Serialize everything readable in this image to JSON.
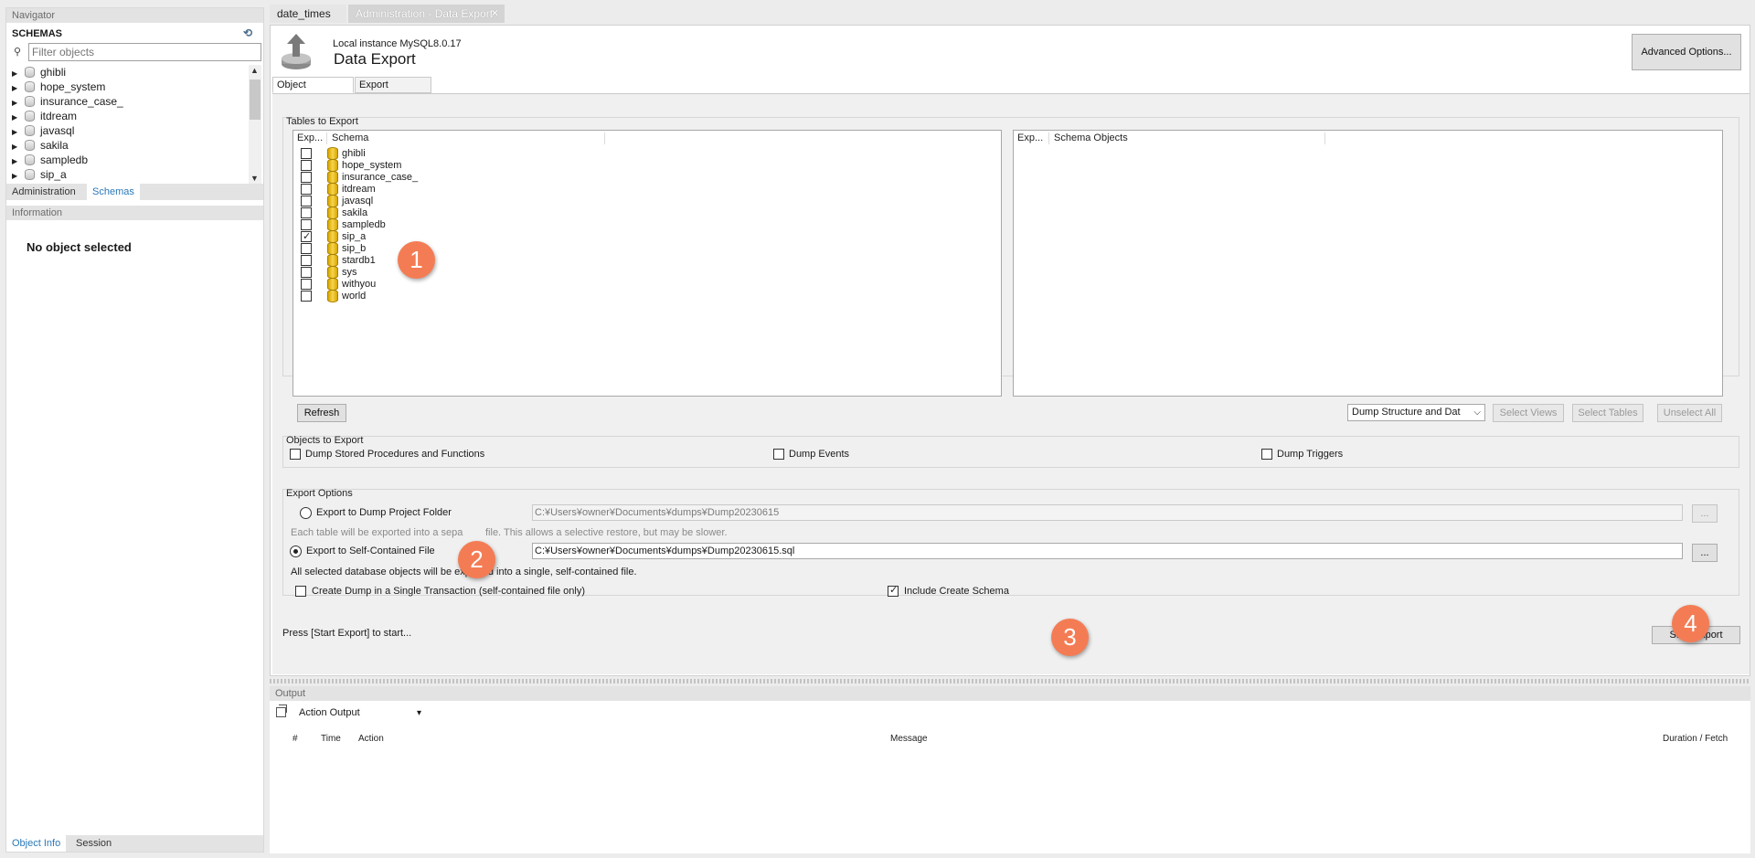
{
  "navigator": {
    "header": "Navigator",
    "schemas_title": "SCHEMAS",
    "filter_placeholder": "Filter objects",
    "schemas": [
      "ghibli",
      "hope_system",
      "insurance_case_",
      "itdream",
      "javasql",
      "sakila",
      "sampledb",
      "sip_a"
    ],
    "tabs": [
      "Administration",
      "Schemas"
    ],
    "selected_tab": "Schemas",
    "info_header": "Information",
    "no_object": "No object selected",
    "bottom_tabs": [
      "Object Info",
      "Session"
    ]
  },
  "doc_tabs": [
    "date_times",
    "Administration - Data Export"
  ],
  "export": {
    "instance": "Local instance MySQL8.0.17",
    "title": "Data Export",
    "advanced_button": "Advanced Options...",
    "subtabs": [
      "Object Selection",
      "Export Progress"
    ],
    "tables_group": "Tables to Export",
    "left_headers": [
      "Exp...",
      "Schema"
    ],
    "right_headers": [
      "Exp...",
      "Schema Objects"
    ],
    "schemas": [
      {
        "name": "ghibli",
        "checked": false
      },
      {
        "name": "hope_system",
        "checked": false
      },
      {
        "name": "insurance_case_",
        "checked": false
      },
      {
        "name": "itdream",
        "checked": false
      },
      {
        "name": "javasql",
        "checked": false
      },
      {
        "name": "sakila",
        "checked": false
      },
      {
        "name": "sampledb",
        "checked": false
      },
      {
        "name": "sip_a",
        "checked": true
      },
      {
        "name": "sip_b",
        "checked": false
      },
      {
        "name": "stardb1",
        "checked": false
      },
      {
        "name": "sys",
        "checked": false
      },
      {
        "name": "withyou",
        "checked": false
      },
      {
        "name": "world",
        "checked": false
      }
    ],
    "refresh_button": "Refresh",
    "dump_select": "Dump Structure and Dat",
    "select_views": "Select Views",
    "select_tables": "Select Tables",
    "unselect_all": "Unselect All",
    "objects_group": "Objects to Export",
    "dump_procs": "Dump Stored Procedures and Functions",
    "dump_events": "Dump Events",
    "dump_triggers": "Dump Triggers",
    "options_group": "Export Options",
    "to_folder": "Export to Dump Project Folder",
    "folder_path": "C:¥Users¥owner¥Documents¥dumps¥Dump20230615",
    "folder_note_a": "Each table will be exported into a sepa",
    "folder_note_b": "file. This allows a selective restore, but may be slower.",
    "to_file": "Export to Self-Contained File",
    "file_path": "C:¥Users¥owner¥Documents¥dumps¥Dump20230615.sql",
    "browse": "...",
    "file_note": "All selected database objects will be exported into a single, self-contained file.",
    "single_tx": "Create Dump in a Single Transaction (self-contained file only)",
    "include_schema": "Include Create Schema",
    "status": "Press [Start Export] to start...",
    "start_button": "Start Export",
    "badges": [
      "1",
      "2",
      "3",
      "4"
    ]
  },
  "output": {
    "header": "Output",
    "action_select": "Action Output",
    "columns": [
      "#",
      "Time",
      "Action",
      "Message",
      "Duration / Fetch"
    ]
  }
}
